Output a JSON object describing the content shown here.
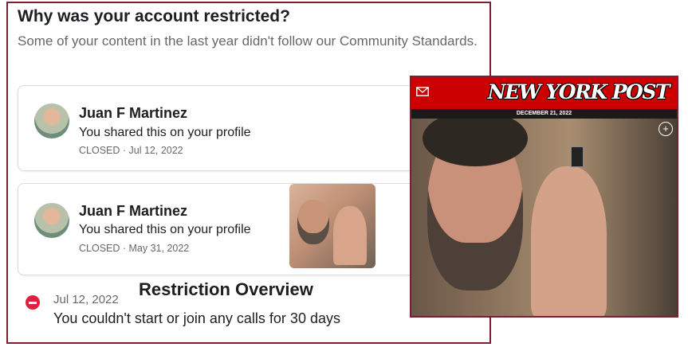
{
  "restriction_panel": {
    "heading": "Why was your account restricted?",
    "subtext": "Some of your content in the last year didn't follow our Community Standards.",
    "items": [
      {
        "author": "Juan F Martinez",
        "description": "You shared this on your profile",
        "status": "CLOSED",
        "date": "Jul 12, 2022"
      },
      {
        "author": "Juan F Martinez",
        "description": "You shared this on your profile",
        "status": "CLOSED",
        "date": "May 31, 2022"
      }
    ],
    "overview": {
      "title": "Restriction Overview",
      "date": "Jul 12, 2022",
      "text": "You couldn't start or join any calls for 30 days"
    }
  },
  "newspaper": {
    "brand": "NEW YORK POST",
    "date": "DECEMBER 21, 2022",
    "icons": [
      "mail-icon",
      "plus-icon"
    ]
  },
  "colors": {
    "frame": "#7a1f2f",
    "nyp_red": "#cc0000",
    "restrict_red": "#e41e3f"
  }
}
